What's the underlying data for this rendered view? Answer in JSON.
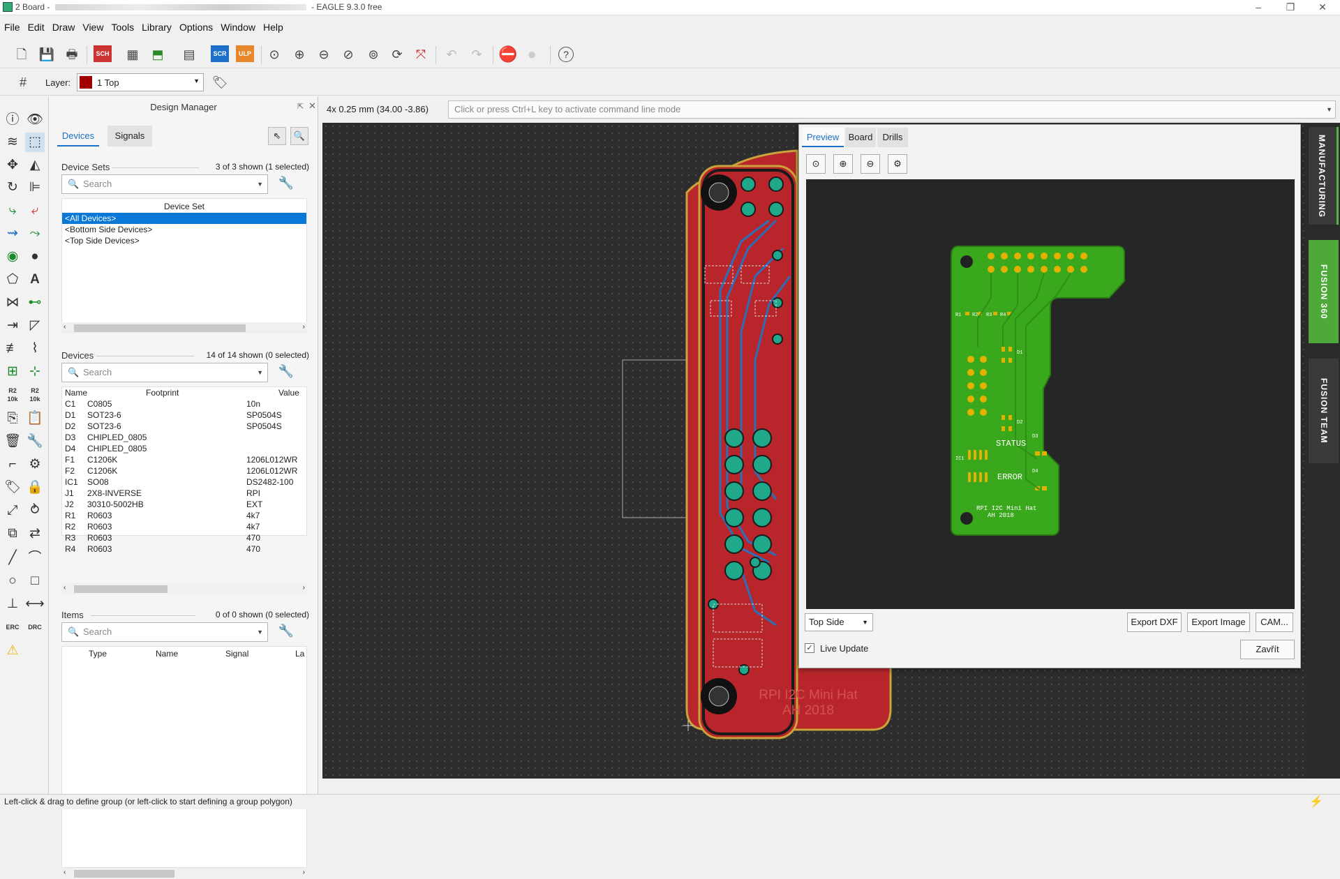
{
  "window": {
    "title_prefix": "2 Board - ",
    "title_suffix": " - EAGLE 9.3.0 free",
    "controls": [
      "–",
      "❐",
      "✕"
    ]
  },
  "menu": [
    "File",
    "Edit",
    "Draw",
    "View",
    "Tools",
    "Library",
    "Options",
    "Window",
    "Help"
  ],
  "toolbar": {
    "layer_label": "Layer:",
    "layer_value": "1 Top",
    "layer_color": "#a00000",
    "scr": "SCR",
    "ulp": "ULP",
    "sch": "SCH"
  },
  "design_manager": {
    "title": "Design Manager",
    "tabs": [
      "Devices",
      "Signals"
    ],
    "device_sets": {
      "label": "Device Sets",
      "count": "3 of 3 shown (1 selected)",
      "search": "Search",
      "column": "Device Set",
      "items": [
        "<All Devices>",
        "<Bottom Side Devices>",
        "<Top Side Devices>"
      ]
    },
    "devices": {
      "label": "Devices",
      "count": "14 of 14 shown (0 selected)",
      "search": "Search",
      "columns": [
        "Name",
        "Footprint",
        "Value"
      ],
      "rows": [
        [
          "C1",
          "C0805",
          "10n"
        ],
        [
          "D1",
          "SOT23-6",
          "SP0504S"
        ],
        [
          "D2",
          "SOT23-6",
          "SP0504S"
        ],
        [
          "D3",
          "CHIPLED_0805",
          ""
        ],
        [
          "D4",
          "CHIPLED_0805",
          ""
        ],
        [
          "F1",
          "C1206K",
          "1206L012WR"
        ],
        [
          "F2",
          "C1206K",
          "1206L012WR"
        ],
        [
          "IC1",
          "SO08",
          "DS2482-100"
        ],
        [
          "J1",
          "2X8-INVERSE",
          "RPI"
        ],
        [
          "J2",
          "30310-5002HB",
          "EXT"
        ],
        [
          "R1",
          "R0603",
          "4k7"
        ],
        [
          "R2",
          "R0603",
          "4k7"
        ],
        [
          "R3",
          "R0603",
          "470"
        ],
        [
          "R4",
          "R0603",
          "470"
        ]
      ]
    },
    "items": {
      "label": "Items",
      "count": "0 of 0 shown (0 selected)",
      "search": "Search",
      "columns": [
        "Type",
        "Name",
        "Signal",
        "La"
      ]
    }
  },
  "coords": "4x 0.25 mm (34.00 -3.86)",
  "command_placeholder": "Click or press Ctrl+L key to activate command line mode",
  "board_silk": {
    "line1": "RPI I2C Mini Hat",
    "line2": "AH 2018"
  },
  "preview": {
    "tabs": [
      "Preview",
      "Board",
      "Drills"
    ],
    "side": "Top Side",
    "buttons": {
      "export_dxf": "Export DXF",
      "export_image": "Export Image",
      "cam": "CAM..."
    },
    "live_update": "Live Update",
    "close": "Zavřít",
    "labels": {
      "status": "STATUS",
      "error": "ERROR",
      "title1": "RPI I2C Mini Hat",
      "title2": "AH 2018",
      "d1": "D1",
      "d2": "D2",
      "d3": "D3",
      "d4": "D4",
      "ic1": "IC1",
      "r1": "R1",
      "r2": "R2",
      "r3": "R3",
      "r4": "R4"
    }
  },
  "right_tabs": [
    "MANUFACTURING",
    "FUSION 360",
    "FUSION TEAM"
  ],
  "status": "Left-click & drag to define group (or left-click to start defining a group polygon)"
}
